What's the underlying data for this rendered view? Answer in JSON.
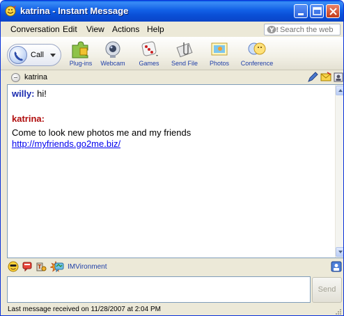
{
  "window": {
    "title": "katrina - Instant Message"
  },
  "menu": {
    "items": [
      "Conversation",
      "Edit",
      "View",
      "Actions",
      "Help"
    ]
  },
  "search": {
    "placeholder": "Search the web"
  },
  "toolbar": {
    "call_label": "Call",
    "tools": [
      "Plug-ins",
      "Webcam",
      "Games",
      "Send File",
      "Photos",
      "Conference"
    ]
  },
  "contact": {
    "name": "katrina"
  },
  "conversation": {
    "messages": [
      {
        "sender": "willy:",
        "text": "hi!"
      },
      {
        "sender": "katrina:",
        "text": "Come to look new photos me and my friends",
        "link": "http://myfriends.go2me.biz/"
      }
    ]
  },
  "emoticons": {
    "imvironment_label": "IMVironment"
  },
  "input": {
    "value": "",
    "send_label": "Send"
  },
  "status": {
    "text": "Last message received on 11/28/2007 at 2:04 PM"
  },
  "colors": {
    "titlebar": "#0a4fd6",
    "sender_willy": "#1a2bb0",
    "sender_katrina": "#b00d0d",
    "link": "#0000ee",
    "tool_label": "#1e3ea8"
  }
}
